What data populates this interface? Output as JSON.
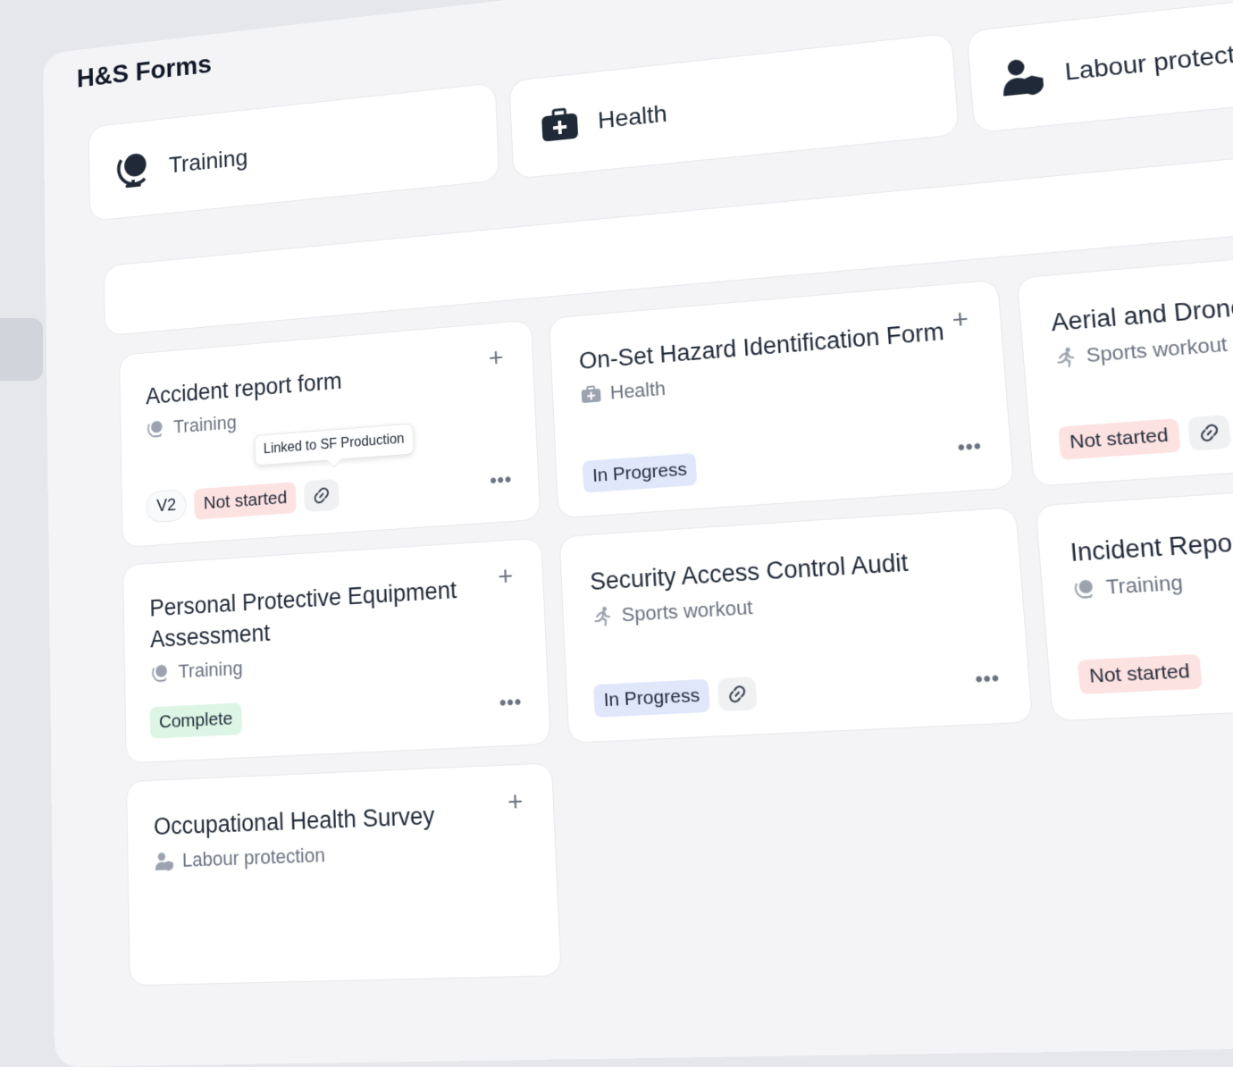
{
  "page_title": "H&S Forms",
  "categories": [
    {
      "label": "Training",
      "icon": "globe-icon"
    },
    {
      "label": "Health",
      "icon": "medkit-icon"
    },
    {
      "label": "Labour protection",
      "icon": "user-shield-icon"
    }
  ],
  "search": {
    "placeholder": ""
  },
  "cards": [
    {
      "title": "Accident report form",
      "category": "Training",
      "category_icon": "globe-icon",
      "version": "V2",
      "status": "Not started",
      "tooltip": "Linked to SF Production"
    },
    {
      "title": "On-Set Hazard Identification Form",
      "category": "Health",
      "category_icon": "medkit-icon",
      "status": "In Progress"
    },
    {
      "title": "Aerial and Drone Safety Survey",
      "category": "Sports workout",
      "category_icon": "runner-icon",
      "status": "Not started"
    },
    {
      "title": "Personal Protective Equipment Assessment",
      "category": "Training",
      "category_icon": "globe-icon",
      "status": "Complete"
    },
    {
      "title": "Security Access Control Audit",
      "category": "Sports workout",
      "category_icon": "runner-icon",
      "status": "In Progress"
    },
    {
      "title": "Incident Report Investigation",
      "category": "Training",
      "category_icon": "globe-icon",
      "status": "Not started"
    },
    {
      "title": "Occupational Health Survey",
      "category": "Labour protection",
      "category_icon": "user-shield-icon"
    }
  ],
  "colors": {
    "not_started_bg": "#fde2e2",
    "in_progress_bg": "#e1e7fb",
    "complete_bg": "#dcf5e4",
    "panel_bg": "#f4f4f6"
  }
}
